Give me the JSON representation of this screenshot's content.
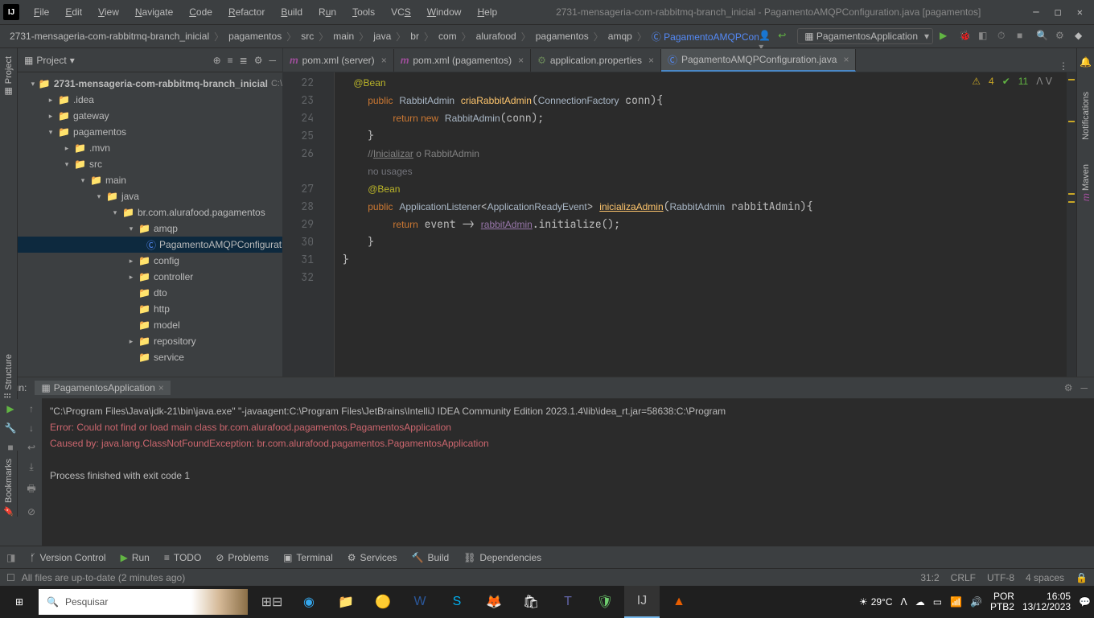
{
  "title": "2731-mensageria-com-rabbitmq-branch_inicial - PagamentoAMQPConfiguration.java [pagamentos]",
  "menu": [
    "File",
    "Edit",
    "View",
    "Navigate",
    "Code",
    "Refactor",
    "Build",
    "Run",
    "Tools",
    "VCS",
    "Window",
    "Help"
  ],
  "breadcrumbs": [
    "2731-mensageria-com-rabbitmq-branch_inicial",
    "pagamentos",
    "src",
    "main",
    "java",
    "br",
    "com",
    "alurafood",
    "pagamentos",
    "amqp",
    "PagamentoAMQPConfiguration"
  ],
  "runconfig": "PagamentosApplication",
  "project": {
    "label": "Project",
    "root": "2731-mensageria-com-rabbitmq-branch_inicial",
    "rootHint": "C:\\",
    "nodes": [
      {
        "pad": 36,
        "arrow": "▸",
        "icon": "📁",
        "name": ".idea"
      },
      {
        "pad": 36,
        "arrow": "▸",
        "icon": "📁",
        "name": "gateway",
        "blue": true
      },
      {
        "pad": 36,
        "arrow": "▾",
        "icon": "📁",
        "name": "pagamentos",
        "blue": true
      },
      {
        "pad": 56,
        "arrow": "▸",
        "icon": "📁",
        "name": ".mvn"
      },
      {
        "pad": 56,
        "arrow": "▾",
        "icon": "📁",
        "name": "src",
        "blue": true
      },
      {
        "pad": 76,
        "arrow": "▾",
        "icon": "📁",
        "name": "main",
        "blue": true
      },
      {
        "pad": 96,
        "arrow": "▾",
        "icon": "📁",
        "name": "java",
        "blue": true
      },
      {
        "pad": 116,
        "arrow": "▾",
        "icon": "📁",
        "name": "br.com.alurafood.pagamentos"
      },
      {
        "pad": 136,
        "arrow": "▾",
        "icon": "📁",
        "name": "amqp"
      },
      {
        "pad": 156,
        "arrow": "",
        "icon": "Ⓒ",
        "name": "PagamentoAMQPConfiguration",
        "sel": true
      },
      {
        "pad": 136,
        "arrow": "▸",
        "icon": "📁",
        "name": "config"
      },
      {
        "pad": 136,
        "arrow": "▸",
        "icon": "📁",
        "name": "controller"
      },
      {
        "pad": 136,
        "arrow": "",
        "icon": "📁",
        "name": "dto"
      },
      {
        "pad": 136,
        "arrow": "",
        "icon": "📁",
        "name": "http"
      },
      {
        "pad": 136,
        "arrow": "",
        "icon": "📁",
        "name": "model"
      },
      {
        "pad": 136,
        "arrow": "▸",
        "icon": "📁",
        "name": "repository"
      },
      {
        "pad": 136,
        "arrow": "",
        "icon": "📁",
        "name": "service"
      }
    ]
  },
  "tabs": [
    {
      "icon": "m",
      "label": "pom.xml (server)"
    },
    {
      "icon": "m",
      "label": "pom.xml (pagamentos)"
    },
    {
      "icon": "p",
      "label": "application.properties"
    },
    {
      "icon": "c",
      "label": "PagamentoAMQPConfiguration.java",
      "active": true
    }
  ],
  "gutterStart": 22,
  "gutterLines": [
    "22",
    "23",
    "24",
    "25",
    "26",
    "",
    "27",
    "28",
    "29",
    "30",
    "31",
    "32"
  ],
  "inspections": {
    "warn": "4",
    "ok": "11"
  },
  "runTab": "PagamentosApplication",
  "runLabel": "Run:",
  "console": {
    "l1": "\"C:\\Program Files\\Java\\jdk-21\\bin\\java.exe\" \"-javaagent:C:\\Program Files\\JetBrains\\IntelliJ IDEA Community Edition 2023.1.4\\lib\\idea_rt.jar=58638:C:\\Program",
    "l2": "Error: Could not find or load main class br.com.alurafood.pagamentos.PagamentosApplication",
    "l3": "Caused by: java.lang.ClassNotFoundException: br.com.alurafood.pagamentos.PagamentosApplication",
    "l4": "Process finished with exit code 1"
  },
  "bottom": [
    "Version Control",
    "Run",
    "TODO",
    "Problems",
    "Terminal",
    "Services",
    "Build",
    "Dependencies"
  ],
  "status": {
    "left": "All files are up-to-date (2 minutes ago)",
    "pos": "31:2",
    "eol": "CRLF",
    "enc": "UTF-8",
    "indent": "4 spaces"
  },
  "taskbar": {
    "search": "Pesquisar",
    "weather": "29°C",
    "lang": "POR",
    "kb": "PTB2",
    "time": "16:05",
    "date": "13/12/2023"
  }
}
